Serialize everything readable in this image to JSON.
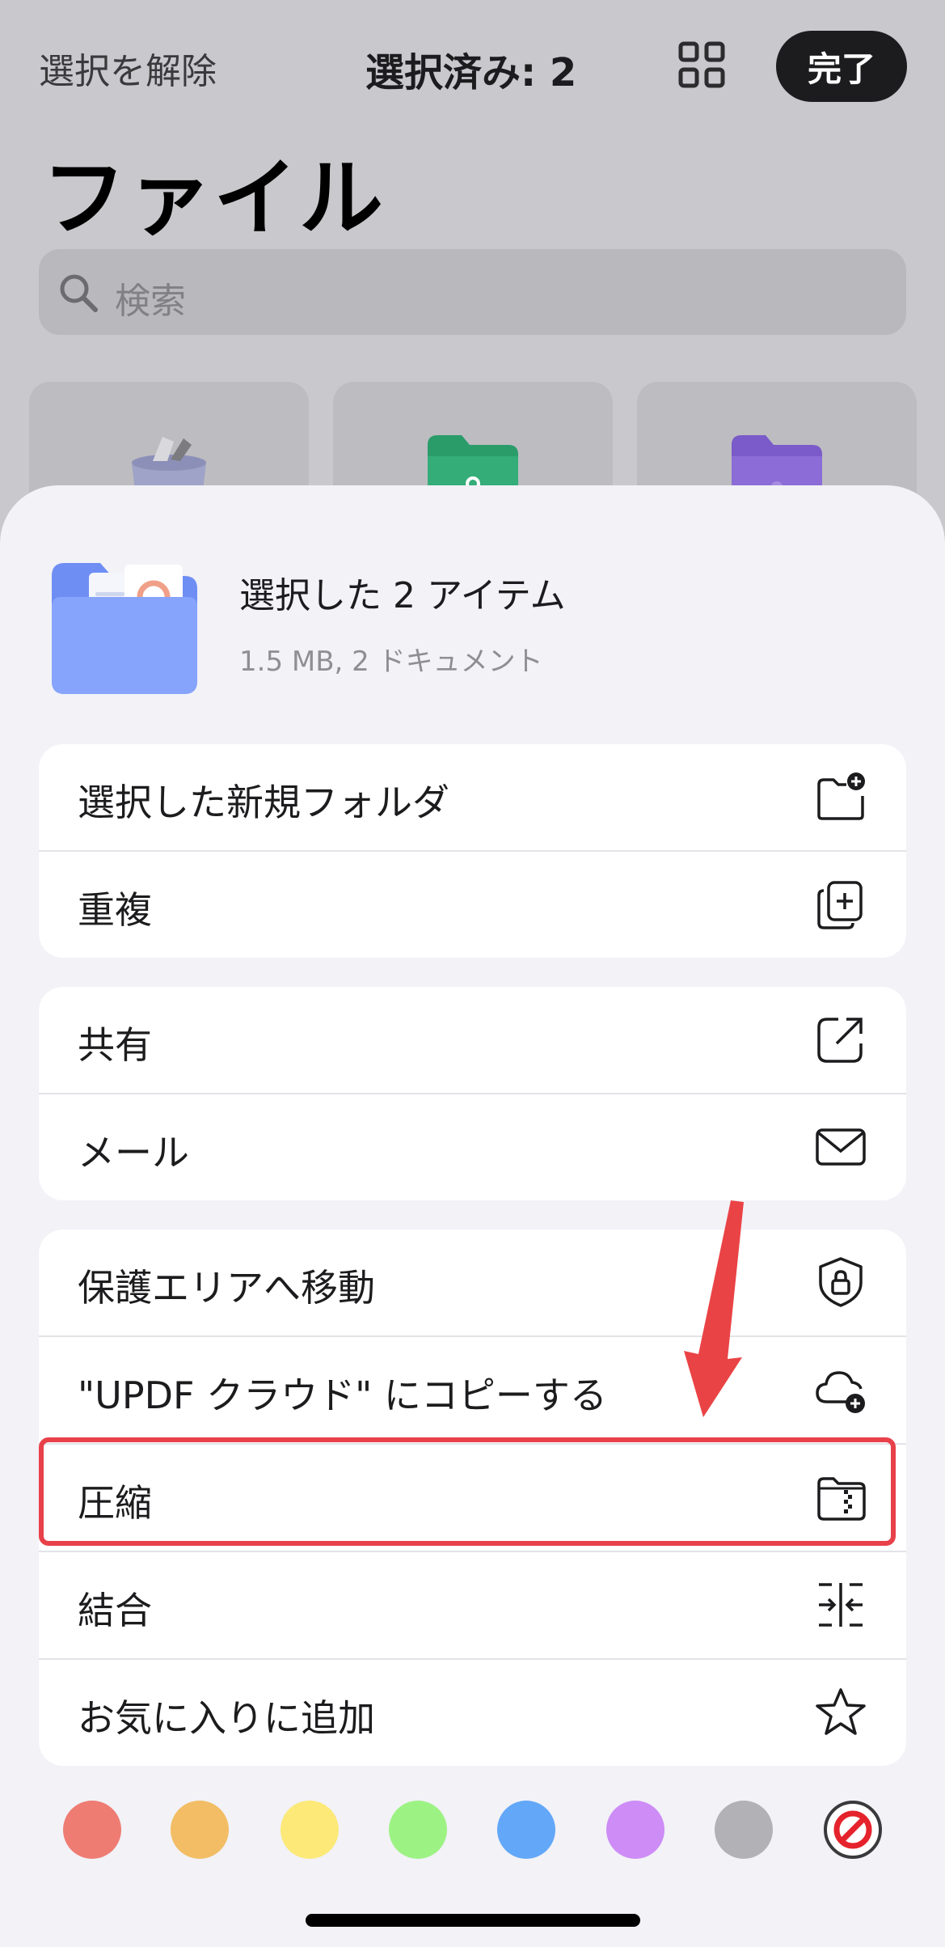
{
  "topbar": {
    "deselect_label": "選択を解除",
    "selection_count": "選択済み: 2",
    "grid_icon": "grid-icon",
    "done_label": "完了"
  },
  "page": {
    "title": "ファイル"
  },
  "search": {
    "placeholder": "検索"
  },
  "cards": [
    {
      "icon": "trash-icon"
    },
    {
      "icon": "green-folder-icon"
    },
    {
      "icon": "purple-folder-icon"
    }
  ],
  "sheet": {
    "header": {
      "title": "選択した 2 アイテム",
      "subtitle": "1.5 MB, 2 ドキュメント"
    },
    "groups": [
      {
        "items": [
          {
            "label": "選択した新規フォルダ",
            "icon": "folder-plus-icon"
          },
          {
            "label": "重複",
            "icon": "duplicate-icon"
          }
        ]
      },
      {
        "items": [
          {
            "label": "共有",
            "icon": "share-icon"
          },
          {
            "label": "メール",
            "icon": "mail-icon"
          }
        ]
      },
      {
        "items": [
          {
            "label": "保護エリアへ移動",
            "icon": "shield-lock-icon"
          },
          {
            "label": " \"UPDF クラウド\" にコピーする",
            "icon": "cloud-plus-icon"
          },
          {
            "label": "圧縮",
            "icon": "zip-folder-icon"
          },
          {
            "label": "結合",
            "icon": "merge-icon"
          },
          {
            "label": "お気に入りに追加",
            "icon": "star-icon"
          }
        ]
      }
    ],
    "color_tags": [
      "#ee7c73",
      "#f2bd64",
      "#fce978",
      "#9df284",
      "#63a7f8",
      "#cd8cf6",
      "#b2b1b6"
    ],
    "clear_tag_icon": "no-color-icon",
    "highlight_color": "#e8414a"
  }
}
